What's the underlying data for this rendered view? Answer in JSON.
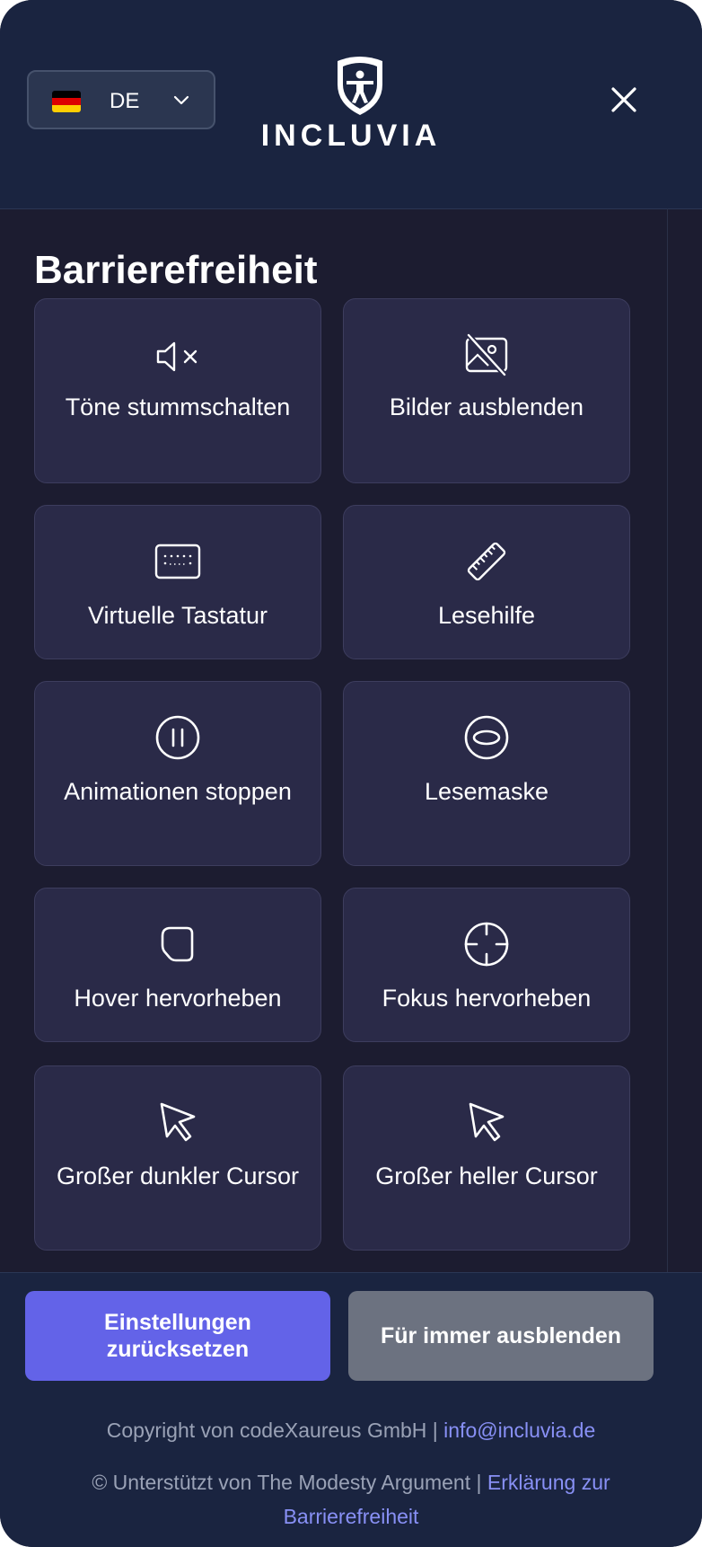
{
  "header": {
    "language": {
      "code": "DE",
      "flag_colors": [
        "#000000",
        "#dd0000",
        "#ffce00"
      ]
    },
    "brand_name": "INCLUVIA",
    "close_icon": "close-icon"
  },
  "main": {
    "title": "Barrierefreiheit",
    "features": [
      {
        "label": "Töne stummschalten",
        "icon": "mute-icon"
      },
      {
        "label": "Bilder ausblenden",
        "icon": "hide-images-icon"
      },
      {
        "label": "Virtuelle Tastatur",
        "icon": "keyboard-icon"
      },
      {
        "label": "Lesehilfe",
        "icon": "ruler-icon"
      },
      {
        "label": "Animationen stoppen",
        "icon": "pause-icon"
      },
      {
        "label": "Lesemaske",
        "icon": "reading-mask-icon"
      },
      {
        "label": "Hover hervorheben",
        "icon": "hover-highlight-icon"
      },
      {
        "label": "Fokus hervorheben",
        "icon": "crosshair-icon"
      },
      {
        "label": "Großer dunkler Cursor",
        "icon": "cursor-icon"
      },
      {
        "label": "Großer heller Cursor",
        "icon": "cursor-icon"
      }
    ]
  },
  "footer": {
    "reset_label": "Einstellungen zurücksetzen",
    "hide_forever_label": "Für immer ausblenden",
    "copyright_text": "Copyright von codeXaureus GmbH | ",
    "email_link": "info@incluvia.de",
    "supported_text": "© Unterstützt von The Modesty Argument | ",
    "statement_link": "Erklärung zur Barrierefreiheit"
  },
  "colors": {
    "background": "#1c1c30",
    "header": "#1a2440",
    "card": "#2a2a48",
    "accent": "#6363e8",
    "secondary_button": "#6c7280",
    "link": "#8890f5"
  }
}
